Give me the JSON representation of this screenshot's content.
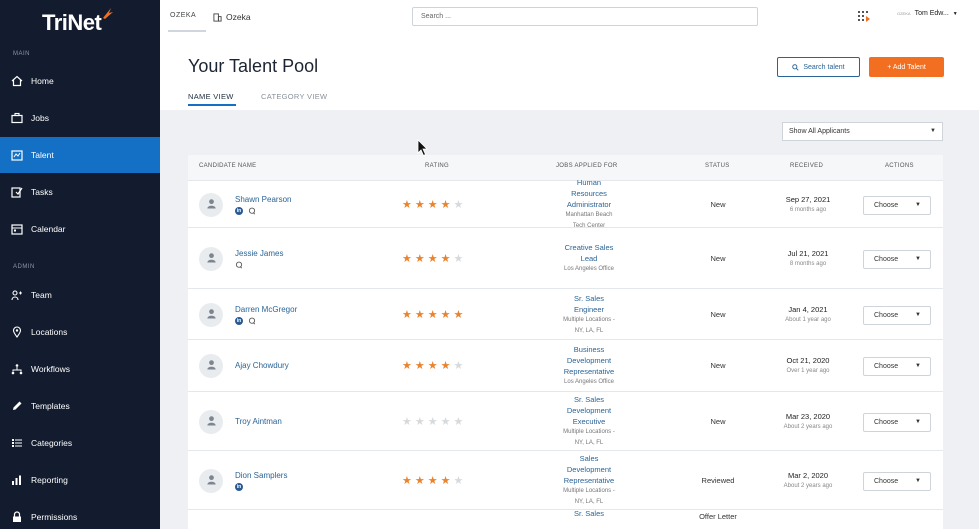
{
  "sidebar": {
    "logo": "TriNet",
    "main_label": "MAIN",
    "admin_label": "ADMIN",
    "items": [
      {
        "label": "Home",
        "icon": "home-icon"
      },
      {
        "label": "Jobs",
        "icon": "briefcase-icon"
      },
      {
        "label": "Talent",
        "icon": "talent-icon",
        "active": true
      },
      {
        "label": "Tasks",
        "icon": "tasks-icon"
      },
      {
        "label": "Calendar",
        "icon": "calendar-icon"
      },
      {
        "label": "Team",
        "icon": "team-icon"
      },
      {
        "label": "Locations",
        "icon": "location-pin-icon"
      },
      {
        "label": "Workflows",
        "icon": "workflow-icon"
      },
      {
        "label": "Templates",
        "icon": "pencil-icon"
      },
      {
        "label": "Categories",
        "icon": "list-icon"
      },
      {
        "label": "Reporting",
        "icon": "bar-chart-icon"
      },
      {
        "label": "Permissions",
        "icon": "lock-icon"
      }
    ]
  },
  "topbar": {
    "org_logo_text": "OZEKA",
    "org_name": "Ozeka",
    "search_placeholder": "Search ...",
    "user_name": "Tom Edw...",
    "user_company_mini": "OZEKA"
  },
  "page": {
    "title": "Your Talent Pool",
    "tab_name_view": "NAME VIEW",
    "tab_category_view": "CATEGORY VIEW",
    "search_talent_label": "Search talent",
    "add_talent_label": "+ Add Talent",
    "filter_value": "Show All Applicants"
  },
  "colors": {
    "sidebar_bg": "#131c2e",
    "active_nav": "#1370c4",
    "accent_orange": "#f26f21",
    "link_blue": "#2a6496",
    "star": "#e9832d"
  },
  "table": {
    "headers": [
      "CANDIDATE NAME",
      "RATING",
      "JOBS APPLIED FOR",
      "STATUS",
      "RECEIVED",
      "ACTIONS"
    ],
    "action_label": "Choose",
    "rows": [
      {
        "name": "Shawn Pearson",
        "linkedin": true,
        "chat": true,
        "rating": 4,
        "job_lines": [
          "Human",
          "Resources",
          "Administrator"
        ],
        "loc_lines": [
          "Manhattan Beach",
          "Tech Center"
        ],
        "status": "New",
        "date": "Sep 27, 2021",
        "ago": "6 months ago"
      },
      {
        "name": "Jessie James",
        "linkedin": false,
        "chat": true,
        "rating": 4,
        "job_lines": [
          "Creative Sales",
          "Lead"
        ],
        "loc_lines": [
          "Los Angeles Office"
        ],
        "status": "New",
        "date": "Jul 21, 2021",
        "ago": "8 months ago"
      },
      {
        "name": "Darren McGregor",
        "linkedin": true,
        "chat": true,
        "rating": 5,
        "job_lines": [
          "Sr. Sales",
          "Engineer"
        ],
        "loc_lines": [
          "Multiple Locations -",
          "NY, LA, FL"
        ],
        "status": "New",
        "date": "Jan 4, 2021",
        "ago": "About 1 year ago"
      },
      {
        "name": "Ajay Chowdury",
        "linkedin": false,
        "chat": false,
        "rating": 4,
        "job_lines": [
          "Business",
          "Development",
          "Representative"
        ],
        "loc_lines": [
          "Los Angeles Office"
        ],
        "status": "New",
        "date": "Oct 21, 2020",
        "ago": "Over 1 year ago"
      },
      {
        "name": "Troy Aintman",
        "linkedin": false,
        "chat": false,
        "rating": 0,
        "job_lines": [
          "Sr. Sales",
          "Development",
          "Executive"
        ],
        "loc_lines": [
          "Multiple Locations -",
          "NY, LA, FL"
        ],
        "status": "New",
        "date": "Mar 23, 2020",
        "ago": "About 2 years ago"
      },
      {
        "name": "Dion Samplers",
        "linkedin": true,
        "chat": false,
        "rating": 4,
        "job_lines": [
          "Sales",
          "Development",
          "Representative"
        ],
        "loc_lines": [
          "Multiple Locations -",
          "NY, LA, FL"
        ],
        "status": "Reviewed",
        "date": "Mar 2, 2020",
        "ago": "About 2 years ago"
      },
      {
        "name": "",
        "linkedin": false,
        "chat": false,
        "rating": -1,
        "job_lines": [
          "Sr. Sales"
        ],
        "loc_lines": [],
        "status": "Offer Letter",
        "date": "",
        "ago": ""
      }
    ]
  }
}
